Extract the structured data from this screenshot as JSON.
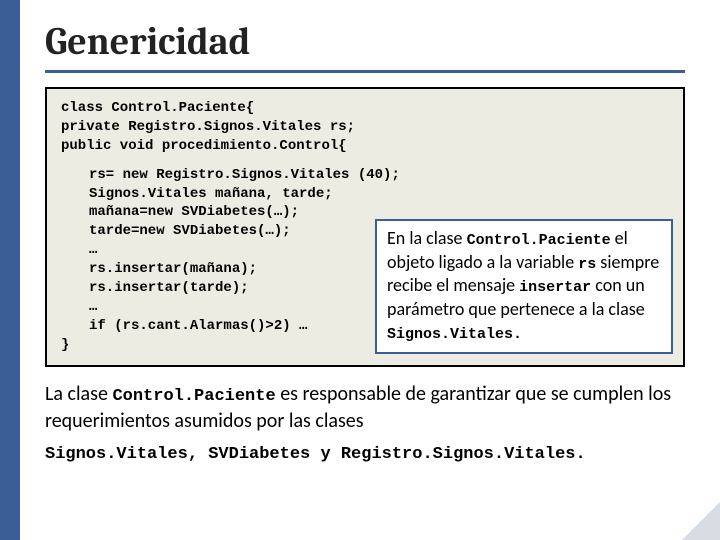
{
  "title": "Genericidad",
  "code": {
    "h1": "class Control.Paciente{",
    "h2": "private Registro.Signos.Vitales rs;",
    "h3": "public void procedimiento.Control{",
    "b1": "rs= new Registro.Signos.Vitales (40);",
    "b2": "Signos.Vitales mañana, tarde;",
    "b3": "mañana=new SVDiabetes(…);",
    "b4": "tarde=new SVDiabetes(…);",
    "b5": "…",
    "b6": "rs.insertar(mañana);",
    "b7": "rs.insertar(tarde);",
    "b8": "…",
    "b9": "",
    "b10": "if (rs.cant.Alarmas()>2) …",
    "end": "}"
  },
  "annotation": {
    "p1a": "En la clase ",
    "p1b": "Control.Paciente",
    "p1c": " el objeto ligado a la variable ",
    "p1d": "rs",
    "p1e": " siempre recibe el mensaje ",
    "p1f": "insertar",
    "p1g": " con un parámetro que pertenece a la  clase ",
    "p1h": "Signos.Vitales."
  },
  "footer": {
    "f1a": "La clase ",
    "f1b": "Control.Paciente",
    "f1c": " es responsable de garantizar que se cumplen los requerimientos asumidos por las clases",
    "f2": "Signos.Vitales, SVDiabetes y Registro.Signos.Vitales."
  }
}
